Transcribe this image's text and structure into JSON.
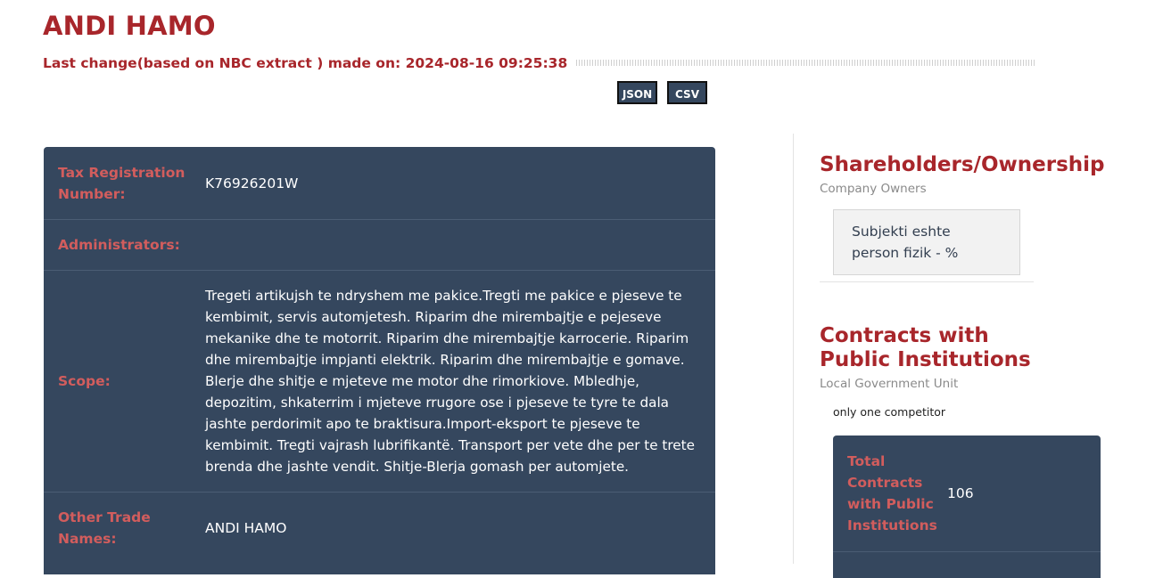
{
  "company": {
    "name": "ANDI HAMO",
    "last_change": "Last change(based on NBC extract ) made on: 2024-08-16 09:25:38"
  },
  "export": {
    "json_label": "JSON",
    "csv_label": "CSV"
  },
  "details": {
    "rows": [
      {
        "label": "Tax Registration Number:",
        "value": "K76926201W"
      },
      {
        "label": "Administrators:",
        "value": ""
      },
      {
        "label": "Scope:",
        "value": "Tregeti artikujsh te ndryshem me pakice.Tregti me pakice e pjeseve te kembimit, servis automjetesh. Riparim dhe mirembajtje e pejeseve mekanike dhe te motorrit. Riparim dhe mirembajtje karrocerie. Riparim dhe mirembajtje impjanti elektrik. Riparim dhe mirembajtje e gomave. Blerje dhe shitje e mjeteve me motor dhe rimorkiove. Mbledhje, depozitim, shkaterrim i mjeteve rrugore ose i pjeseve te tyre te dala jashte perdorimit apo te braktisura.Import-eksport te pjeseve te kembimit. Tregti vajrash lubrifikantë. Transport per vete dhe per te trete brenda dhe jashte vendit. Shitje-Blerja gomash per automjete."
      },
      {
        "label": "Other Trade Names:",
        "value": "ANDI HAMO"
      }
    ]
  },
  "shareholders": {
    "heading": "Shareholders/Ownership",
    "subheading": "Company Owners",
    "owner_text": "Subjekti eshte person fizik - %"
  },
  "contracts": {
    "heading": "Contracts with Public Institutions",
    "subheading": "Local Government Unit",
    "note": "only one competitor",
    "total_label": "Total Contracts with Public Institutions",
    "total_value": "106"
  }
}
